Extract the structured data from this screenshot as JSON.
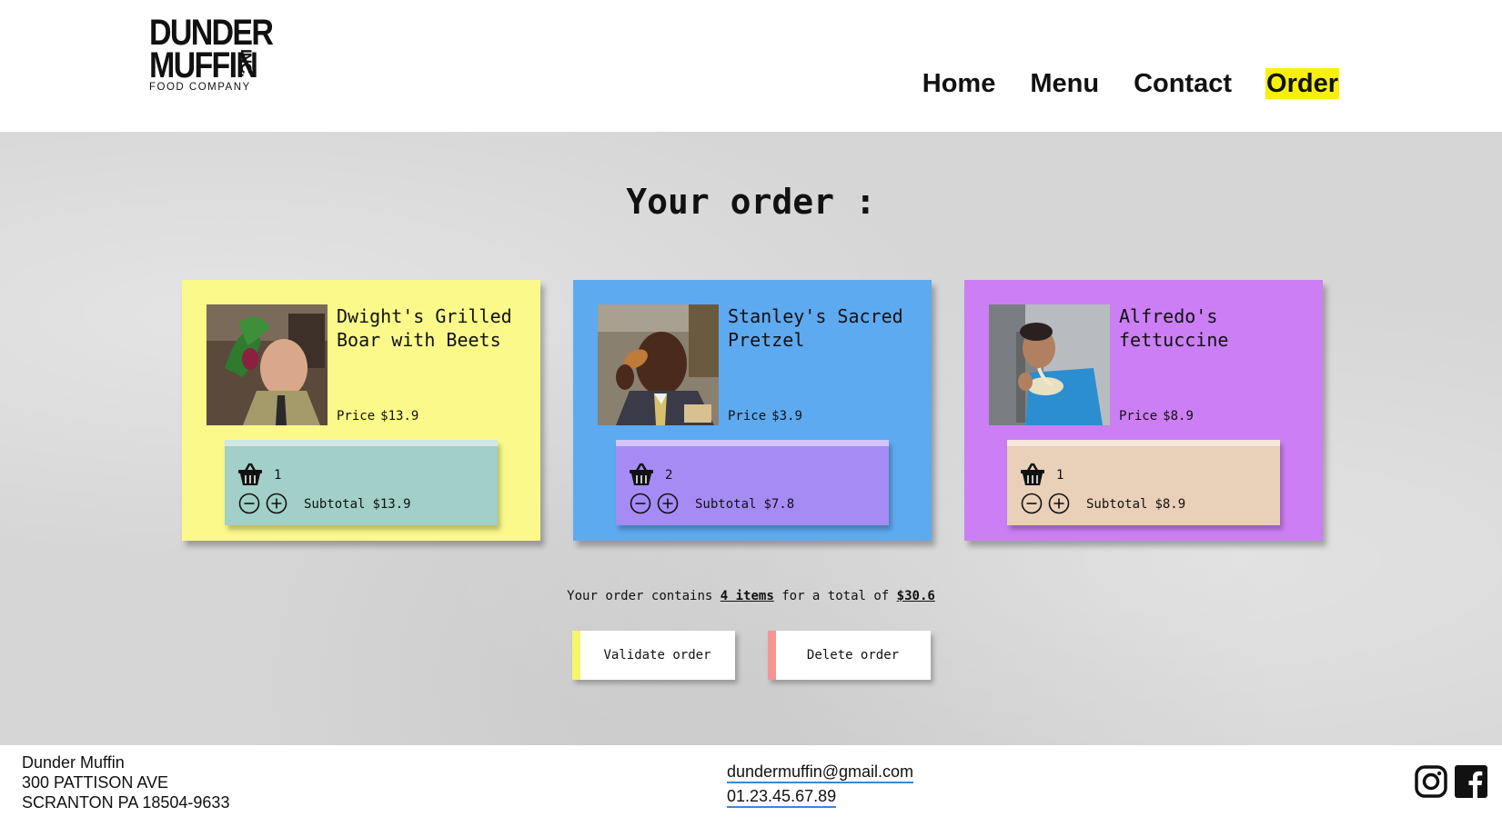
{
  "header": {
    "logo": {
      "line1": "DUNDER",
      "line2": "MUFFIN",
      "inc": "INC.",
      "sub": "FOOD COMPANY"
    },
    "nav": [
      {
        "label": "Home",
        "active": false
      },
      {
        "label": "Menu",
        "active": false
      },
      {
        "label": "Contact",
        "active": false
      },
      {
        "label": "Order",
        "active": true
      }
    ]
  },
  "main": {
    "title": "Your order :",
    "items": [
      {
        "name": "Dwight's Grilled Boar with Beets",
        "price_label": "Price",
        "price": "$13.9",
        "qty": "1",
        "subtotal_label": "Subtotal",
        "subtotal": "$13.9",
        "card_color": "#fbf98a",
        "cart_color": "#a2cfc7"
      },
      {
        "name": "Stanley's Sacred Pretzel",
        "price_label": "Price",
        "price": "$3.9",
        "qty": "2",
        "subtotal_label": "Subtotal",
        "subtotal": "$7.8",
        "card_color": "#5eaaf0",
        "cart_color": "#a58cf5"
      },
      {
        "name": "Alfredo's fettuccine",
        "price_label": "Price",
        "price": "$8.9",
        "qty": "1",
        "subtotal_label": "Subtotal",
        "subtotal": "$8.9",
        "card_color": "#cc7ff5",
        "cart_color": "#e9d0b8"
      }
    ],
    "summary": {
      "prefix": "Your order contains",
      "items": "4 items",
      "middle": "for a total of",
      "total": "$30.6"
    },
    "validate_label": "Validate order",
    "delete_label": "Delete order"
  },
  "footer": {
    "name": "Dunder Muffin",
    "street": "300 PATTISON AVE",
    "city": "SCRANTON PA 18504-9633",
    "email": "dundermuffin@gmail.com",
    "phone": "01.23.45.67.89",
    "social": [
      "instagram-icon",
      "facebook-icon"
    ]
  }
}
